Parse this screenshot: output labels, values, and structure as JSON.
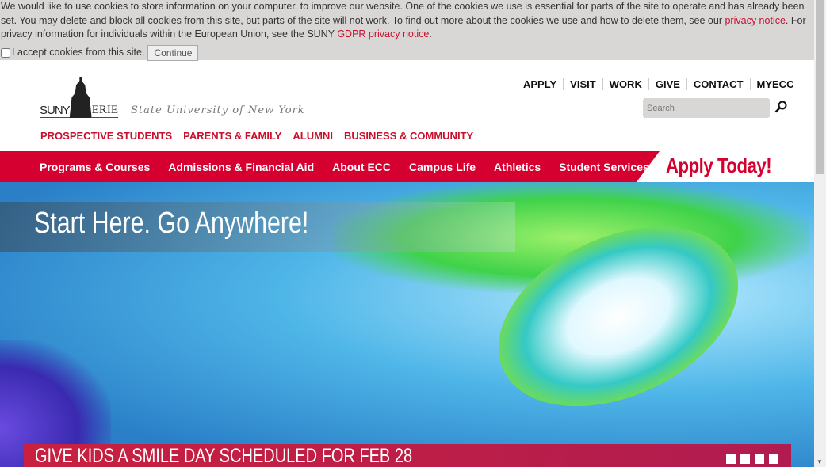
{
  "cookie": {
    "text1": "We would like to use cookies to store information on your computer, to improve our website. One of the cookies we use is essential for parts of the site to operate and has already been set. You may delete and block all cookies from this site, but parts of the site will not work. To find out more about the cookies we use and how to delete them, see our ",
    "link1": "privacy notice",
    "text2": ". For privacy information for individuals within the European Union, see the SUNY ",
    "link2": "GDPR privacy notice",
    "text3": ".",
    "checkbox_label": "I accept cookies from this site.",
    "continue": "Continue"
  },
  "logo": {
    "suny": "SUNY",
    "erie": "ERIE",
    "subtitle": "State University of New York"
  },
  "audience": [
    "PROSPECTIVE STUDENTS",
    "PARENTS & FAMILY",
    "ALUMNI",
    "BUSINESS & COMMUNITY"
  ],
  "utility": [
    "APPLY",
    "VISIT",
    "WORK",
    "GIVE",
    "CONTACT",
    "MYECC"
  ],
  "search": {
    "placeholder": "Search"
  },
  "nav": [
    "Programs & Courses",
    "Admissions & Financial Aid",
    "About ECC",
    "Campus Life",
    "Athletics",
    "Student Services"
  ],
  "apply_today": "Apply Today!",
  "hero": {
    "tagline": "Start Here. Go Anywhere!",
    "headline": "GIVE KIDS A SMILE DAY SCHEDULED FOR FEB 28",
    "slides": 4
  }
}
